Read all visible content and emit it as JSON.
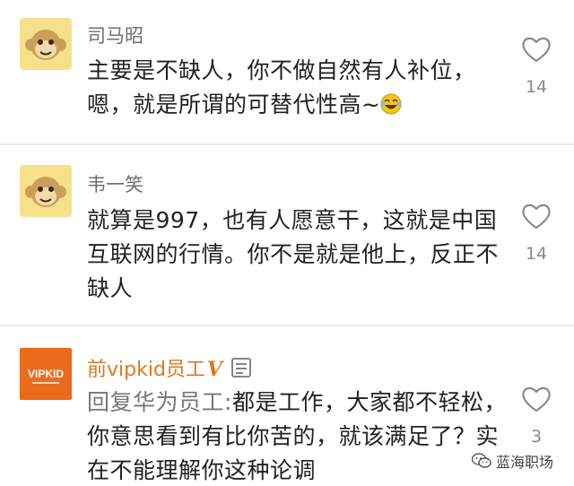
{
  "comments": [
    {
      "username": "司马昭",
      "avatar_icon": "monkey-avatar-icon",
      "line1": "主要是不缺人，你不做自然有人补位，",
      "line2": "嗯，就是所谓的可替代性高~",
      "emoji_icon": "laughing-tears-emoji-icon",
      "like_count": "14"
    },
    {
      "username": "韦一笑",
      "avatar_icon": "monkey-avatar-icon",
      "line1": "就算是997，也有人愿意干，这就是中国",
      "line2": "互联网的行情。你不是就是他上，反正不",
      "line3": "缺人",
      "like_count": "14"
    },
    {
      "username": "前vipkid员工",
      "username_badge": "V",
      "avatar_text": "VIPKID",
      "reply_prefix": "回复华为员工:",
      "line1": "都是工作，大家都不轻松，",
      "line2": "你意思看到有比你苦的，就该满足了？实",
      "line3": "在不能理解你这种论调",
      "like_count": "3"
    }
  ],
  "watermark": {
    "text": "蓝海职场",
    "icon": "wechat-icon"
  },
  "colors": {
    "username_gray": "#6f6f6f",
    "username_orange": "#d97a1c",
    "avatar_yellow": "#f7e08a",
    "vipkid_orange": "#ea6b1c"
  }
}
